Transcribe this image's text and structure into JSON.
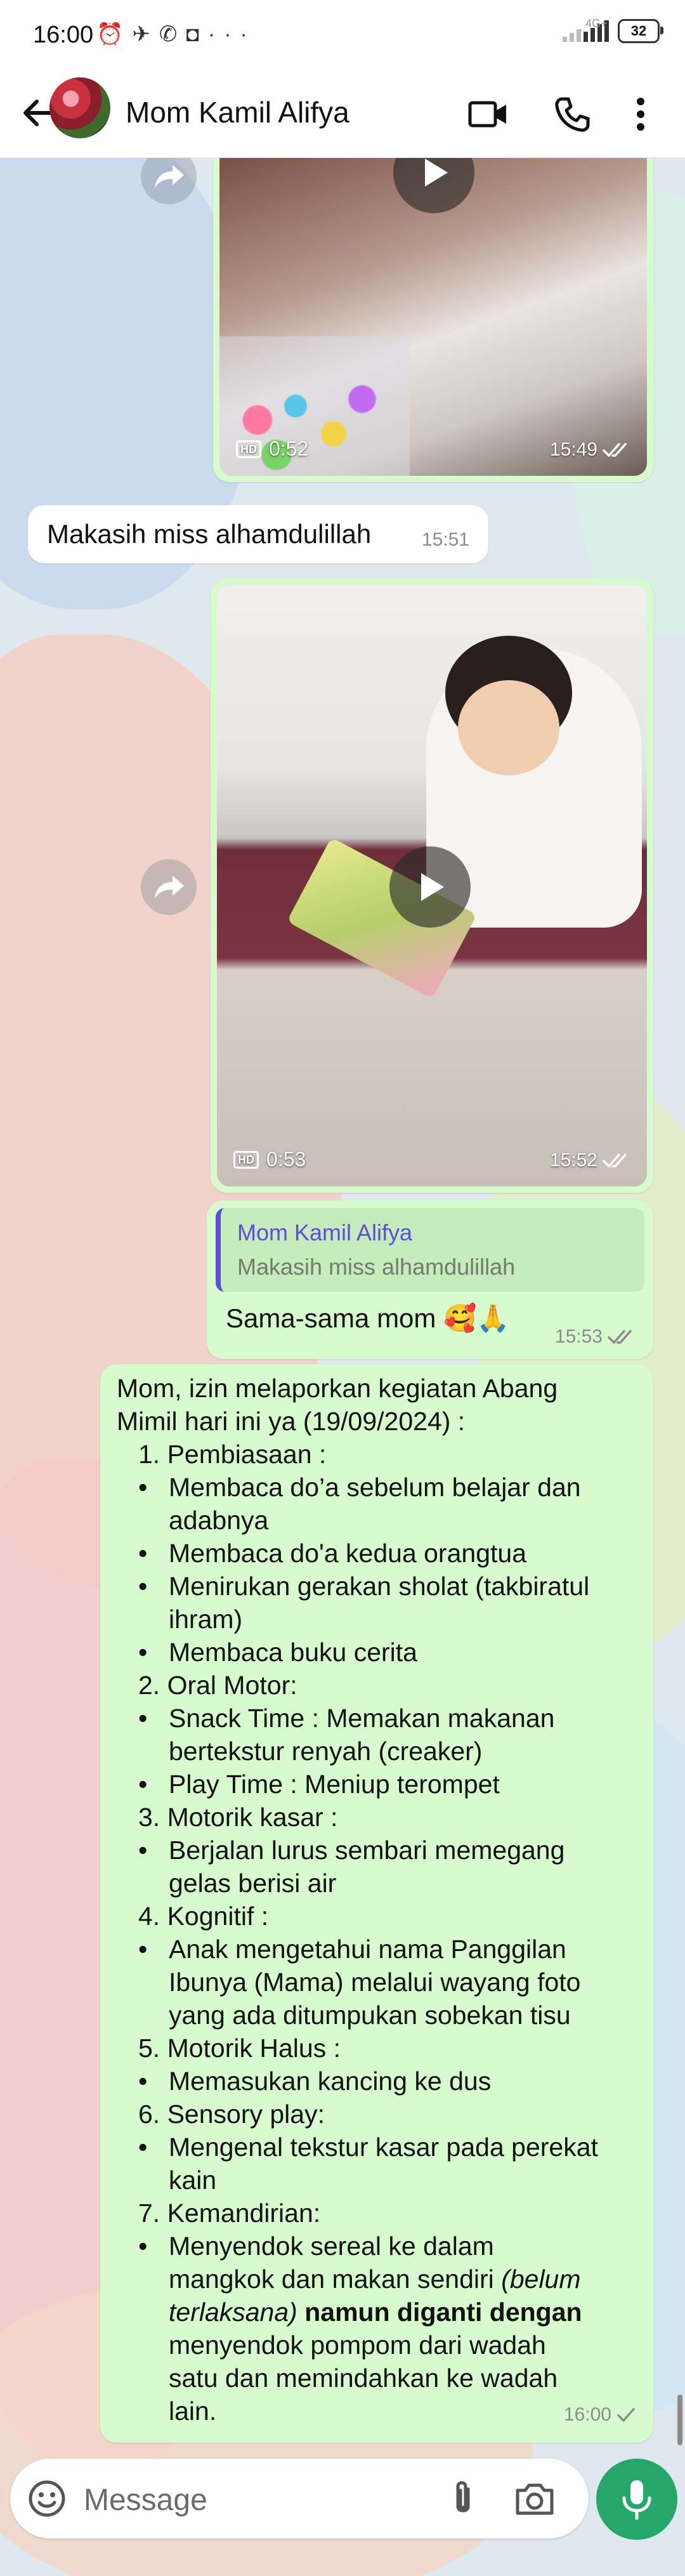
{
  "status_bar": {
    "time": "16:00",
    "icons": [
      "alarm-icon",
      "telegram-icon",
      "whatsapp-icon",
      "instagram-icon",
      "more-icon"
    ],
    "network": "4G+",
    "battery": "32"
  },
  "app_bar": {
    "contact_name": "Mom Kamil Alifya"
  },
  "messages": {
    "video1": {
      "duration": "0:52",
      "time": "15:49"
    },
    "incoming1": {
      "text": "Makasih miss alhamdulillah",
      "time": "15:51"
    },
    "video2": {
      "duration": "0:53",
      "time": "15:52"
    },
    "reply": {
      "quote_name": "Mom Kamil Alifya",
      "quote_text": "Makasih miss alhamdulillah",
      "text": "Sama-sama mom 🥰🙏",
      "time": "15:53"
    },
    "report": {
      "time": "16:00",
      "lines": [
        "Mom, izin melaporkan kegiatan Abang",
        "Mimil hari ini ya (19/09/2024) :",
        "1. Pembiasaan :",
        "Membaca do’a sebelum belajar dan",
        "adabnya",
        "Membaca do'a kedua orangtua",
        "Menirukan gerakan sholat (takbiratul",
        "ihram)",
        "Membaca buku cerita",
        "2. Oral Motor:",
        "Snack Time : Memakan makanan",
        "bertekstur renyah (creaker)",
        "Play Time : Meniup terompet",
        "3. Motorik kasar :",
        "Berjalan lurus sembari memegang",
        "gelas berisi air",
        "4. Kognitif :",
        "Anak mengetahui nama Panggilan",
        "Ibunya (Mama) melalui wayang foto",
        "yang ada ditumpukan sobekan tisu",
        "5. Motorik Halus :",
        "Memasukan kancing ke dus",
        "6. Sensory play:",
        "Mengenal tekstur kasar pada perekat",
        "kain",
        "7. Kemandirian:",
        "Menyendok sereal ke dalam",
        "mangkok dan makan sendiri",
        "(belum",
        "terlaksana)",
        "namun diganti dengan",
        "menyendok pompom dari wadah",
        "satu dan memindahkan ke wadah",
        "lain."
      ]
    }
  },
  "input": {
    "placeholder": "Message"
  },
  "colors": {
    "outgoing_bubble": "#d7fbce",
    "incoming_bubble": "#ffffff",
    "quote_accent": "#5b4fd8",
    "mic_button": "#25a66a"
  }
}
